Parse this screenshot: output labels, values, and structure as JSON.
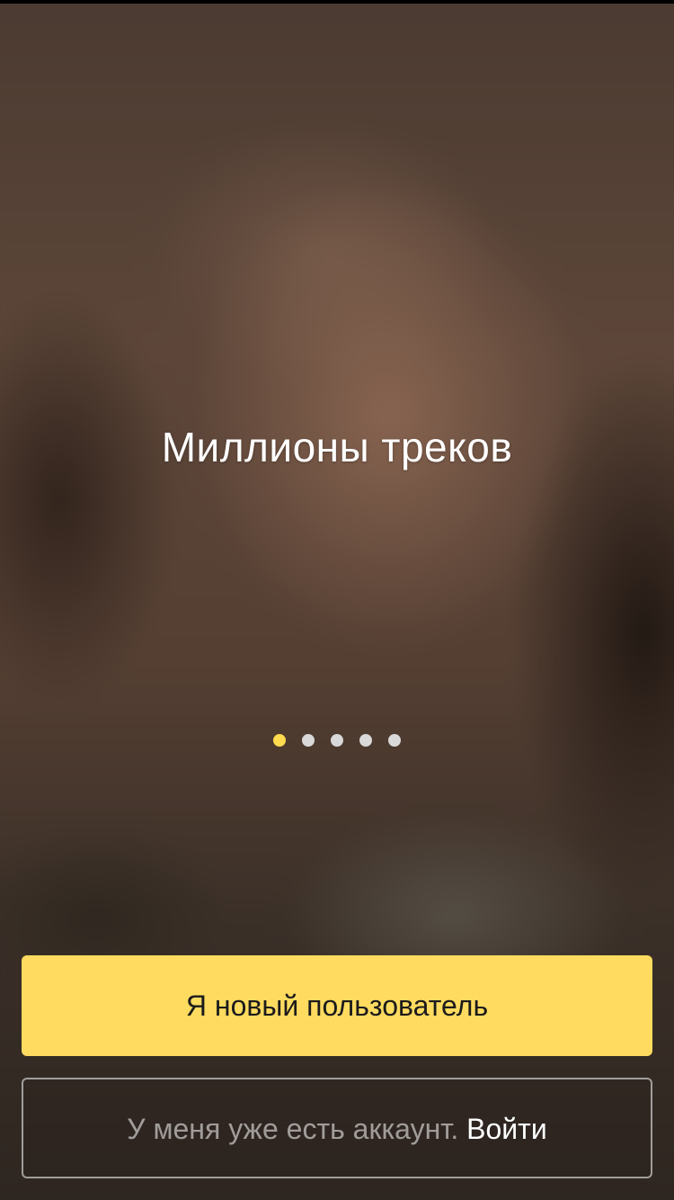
{
  "onboarding": {
    "headline": "Миллионы треков",
    "pager": {
      "total": 5,
      "active_index": 0,
      "active_color": "#ffdb4d",
      "inactive_color": "#d9d9d9"
    }
  },
  "actions": {
    "new_user_label": "Я новый пользователь",
    "have_account_text": "У меня уже есть аккаунт.",
    "login_label": "Войти"
  },
  "colors": {
    "primary_button": "#ffdb60"
  }
}
